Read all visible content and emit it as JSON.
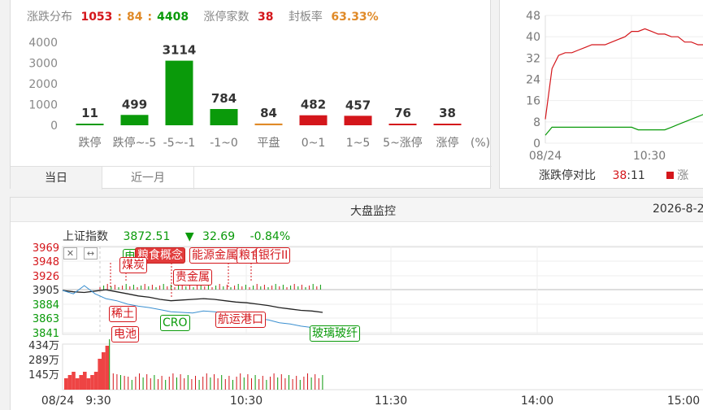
{
  "distribution": {
    "label": "涨跌分布",
    "up": "1053",
    "sep1": ":",
    "flat": "84",
    "sep2": ":",
    "down": "4408",
    "limit_up_label": "涨停家数",
    "limit_up_count": "38",
    "seal_rate_label": "封板率",
    "seal_rate": "63.33%",
    "tabs": [
      "当日",
      "近一月"
    ],
    "unit": "(%)"
  },
  "chart_data": [
    {
      "type": "bar",
      "title": "",
      "categories": [
        "跌停",
        "跌停~-5",
        "-5~-1",
        "-1~0",
        "平盘",
        "0~1",
        "1~5",
        "5~涨停",
        "涨停"
      ],
      "values": [
        11,
        499,
        3114,
        784,
        84,
        482,
        457,
        76,
        38
      ],
      "colors": [
        "#0a9a0a",
        "#0a9a0a",
        "#0a9a0a",
        "#0a9a0a",
        "#e08a28",
        "#d4161b",
        "#d4161b",
        "#d4161b",
        "#d4161b"
      ],
      "y_ticks": [
        "4000",
        "3000",
        "2000",
        "1000",
        "0"
      ],
      "ylim": [
        0,
        4000
      ],
      "xlabel": "(%)",
      "grid": false
    },
    {
      "type": "line",
      "title": "",
      "x_ticks": [
        "08/24",
        "10:30"
      ],
      "y_ticks": [
        "48",
        "40",
        "32",
        "24",
        "16",
        "8",
        "0"
      ],
      "ylim": [
        0,
        48
      ],
      "series": [
        {
          "color": "#d4161b",
          "values": [
            9,
            28,
            33,
            34,
            34,
            35,
            36,
            37,
            37,
            37,
            38,
            39,
            40,
            42,
            42,
            43,
            42,
            41,
            41,
            40,
            40,
            38,
            38,
            37,
            37
          ]
        },
        {
          "color": "#0a9a0a",
          "values": [
            3,
            6,
            6,
            6,
            6,
            6,
            6,
            6,
            6,
            6,
            6,
            6,
            6,
            6,
            5,
            5,
            5,
            5,
            5,
            6,
            7,
            8,
            9,
            10,
            11
          ]
        }
      ],
      "legend_label": "涨跌停对比",
      "legend_up": "38",
      "legend_sep": ":",
      "legend_down": "11"
    },
    {
      "type": "line",
      "title": "大盘监控",
      "x_ticks": [
        "08/24",
        "9:30",
        "10:30",
        "11:30",
        "14:00",
        "15:00"
      ],
      "y_ticks": [
        "3969",
        "3948",
        "3926",
        "3905",
        "3884",
        "3863",
        "3841"
      ],
      "ylim": [
        3841,
        3969
      ],
      "series": [
        {
          "color": "#222222",
          "values": [
            3905,
            3903,
            3902,
            3904,
            3906,
            3903,
            3900,
            3897,
            3895,
            3892,
            3890,
            3891,
            3892,
            3893,
            3892,
            3890,
            3888,
            3887,
            3885,
            3883,
            3880,
            3878,
            3876,
            3875,
            3873
          ]
        },
        {
          "color": "#3a8fd0",
          "values": [
            3905,
            3900,
            3912,
            3900,
            3893,
            3890,
            3885,
            3882,
            3880,
            3877,
            3874,
            3873,
            3872,
            3875,
            3874,
            3872,
            3868,
            3866,
            3864,
            3862,
            3858,
            3856,
            3853,
            3851,
            3849
          ]
        }
      ],
      "volume_ticks": [
        "434万",
        "289万",
        "145万"
      ]
    }
  ],
  "monitor": {
    "title": "大盘监控",
    "date": "2026-8-2",
    "index_name": "上证指数",
    "index_value": "3872.51",
    "arrow": "▼",
    "change": "32.69",
    "change_pct": "-0.84%",
    "tags": {
      "coal": "煤炭",
      "grain1": "粮食概念",
      "energy_metal": "能源金属",
      "grain2": "粮食",
      "bank": "银行II",
      "precious": "贵金属",
      "rare_earth": "稀土",
      "battery": "电池",
      "cro": "CRO",
      "shipping": "航运港口",
      "glass": "玻璃玻纤",
      "grain_letter": "电"
    },
    "ctrl_left": "✕",
    "ctrl_right": "↔"
  }
}
